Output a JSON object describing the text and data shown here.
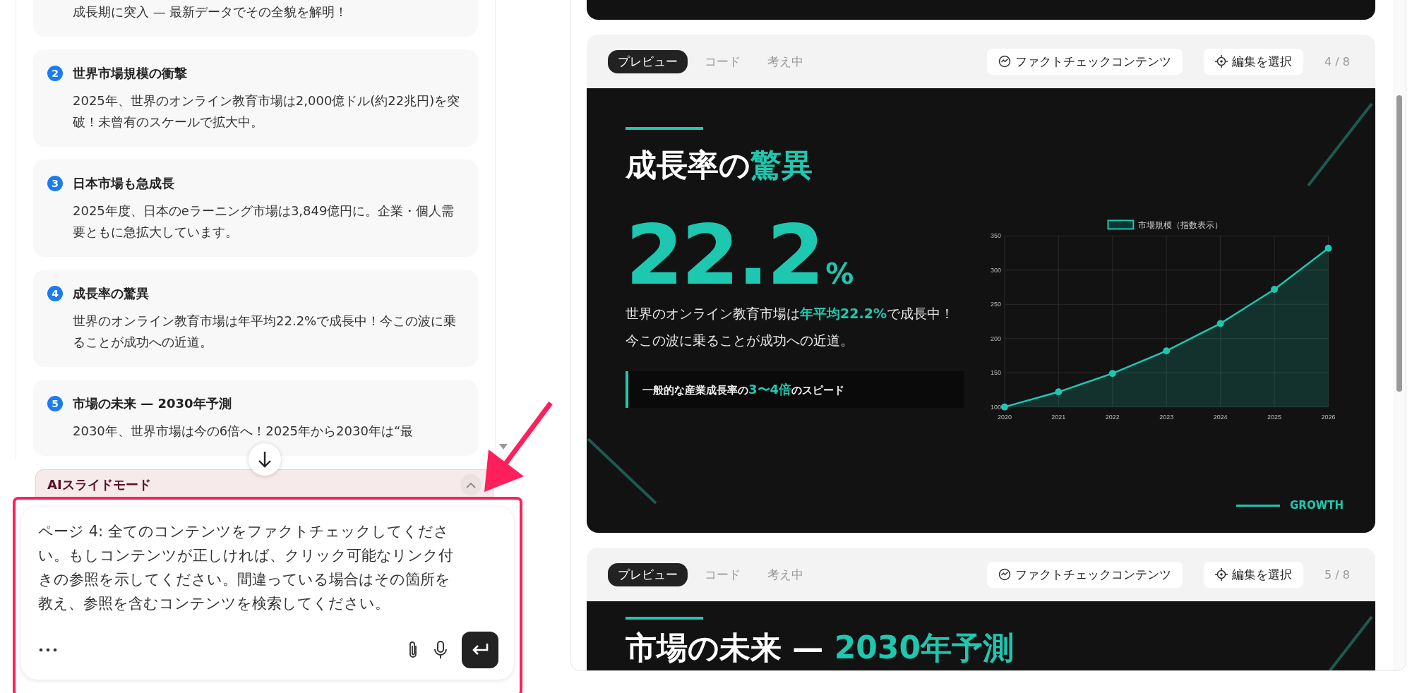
{
  "chat_panel": {
    "cards": [
      {
        "body": "成長期に突入 — 最新データでその全貌を解明！"
      },
      {
        "number": "2",
        "title": "世界市場規模の衝撃",
        "body": "2025年、世界のオンライン教育市場は2,000億ドル(約22兆円)を突破！未曾有のスケールで拡大中。"
      },
      {
        "number": "3",
        "title": "日本市場も急成長",
        "body": "2025年度、日本のeラーニング市場は3,849億円に。企業・個人需要ともに急拡大しています。"
      },
      {
        "number": "4",
        "title": "成長率の驚異",
        "body": "世界のオンライン教育市場は年平均22.2%で成長中！今この波に乗ることが成功への近道。"
      },
      {
        "number": "5",
        "title": "市場の未来 — 2030年予測",
        "body": "2030年、世界市場は今の6倍へ！2025年から2030年は“最"
      }
    ]
  },
  "mode_bar": {
    "label": "AIスライドモード"
  },
  "prompt": {
    "value": "ページ 4: 全てのコンテンツをファクトチェックしてください。もしコンテンツが正しければ、クリック可能なリンク付きの参照を示してください。間違っている場合はその箇所を教え、参照を含むコンテンツを検索してください。"
  },
  "slides": [
    {
      "header": {
        "tabs": [
          {
            "label": "プレビュー",
            "selected": true
          },
          {
            "label": "コード",
            "selected": false
          },
          {
            "label": "考え中",
            "selected": false
          }
        ],
        "fact_check": "ファクトチェックコンテンツ",
        "edit_select": "編集を選択",
        "page": "4 / 8"
      },
      "title": "成長率の**驚異**",
      "stat_value": "22.2",
      "stat_unit": "%",
      "paragraphs": [
        "世界のオンライン教育市場は**年平均22.2%**で成長中！",
        "今この波に乗ることが成功への近道。"
      ],
      "callout": "一般的な産業成長率の**3〜4倍**のスピード",
      "chart_data": {
        "type": "area",
        "categories": [
          "2020",
          "2021",
          "2022",
          "2023",
          "2024",
          "2025",
          "2026"
        ],
        "series": [
          {
            "name": "市場規模（指数表示）",
            "color": "#1ec8b0",
            "values": [
              100,
              122,
              149,
              182,
              222,
              272,
              332
            ]
          }
        ],
        "grid": true,
        "ylim": [
          100,
          350
        ],
        "yticks": [
          100,
          150,
          200,
          250,
          300,
          350
        ]
      },
      "footer_label": "GROWTH"
    },
    {
      "header": {
        "tabs": [
          {
            "label": "プレビュー",
            "selected": true
          },
          {
            "label": "コード",
            "selected": false
          },
          {
            "label": "考え中",
            "selected": false
          }
        ],
        "fact_check": "ファクトチェックコンテンツ",
        "edit_select": "編集を選択",
        "page": "5 / 8"
      },
      "title": "市場の未来 — **2030年予測**"
    }
  ]
}
